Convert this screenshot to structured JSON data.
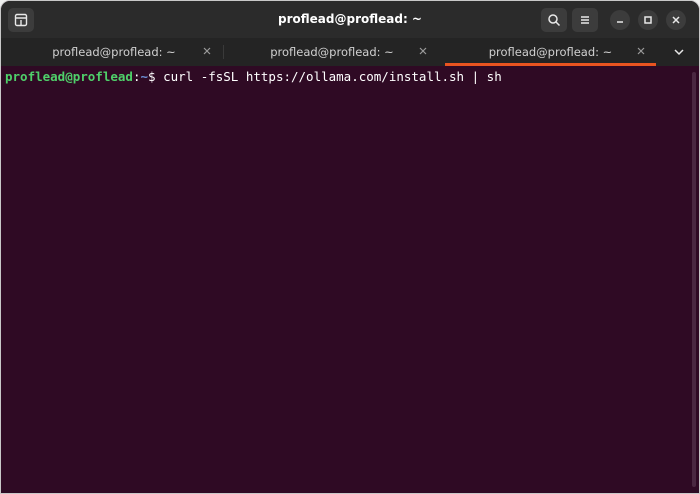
{
  "window": {
    "title": "proflead@proflead: ~"
  },
  "titlebar": {
    "new_tab_icon": "new-tab-icon",
    "search_icon": "search-icon",
    "menu_icon": "hamburger-menu-icon",
    "minimize_icon": "minimize-icon",
    "maximize_icon": "maximize-icon",
    "close_icon": "close-icon"
  },
  "tabs": [
    {
      "label": "proflead@proflead: ~",
      "active": false
    },
    {
      "label": "proflead@proflead: ~",
      "active": false
    },
    {
      "label": "proflead@proflead: ~",
      "active": true
    }
  ],
  "terminal": {
    "prompt_user": "proflead@proflead",
    "prompt_sep": ":",
    "prompt_path": "~",
    "prompt_symbol": "$ ",
    "command": "curl -fsSL https://ollama.com/install.sh | sh"
  },
  "colors": {
    "terminal_bg": "#2f0a24",
    "accent": "#e95420",
    "prompt_user": "#4fd06a",
    "prompt_path": "#6b8fd4"
  }
}
